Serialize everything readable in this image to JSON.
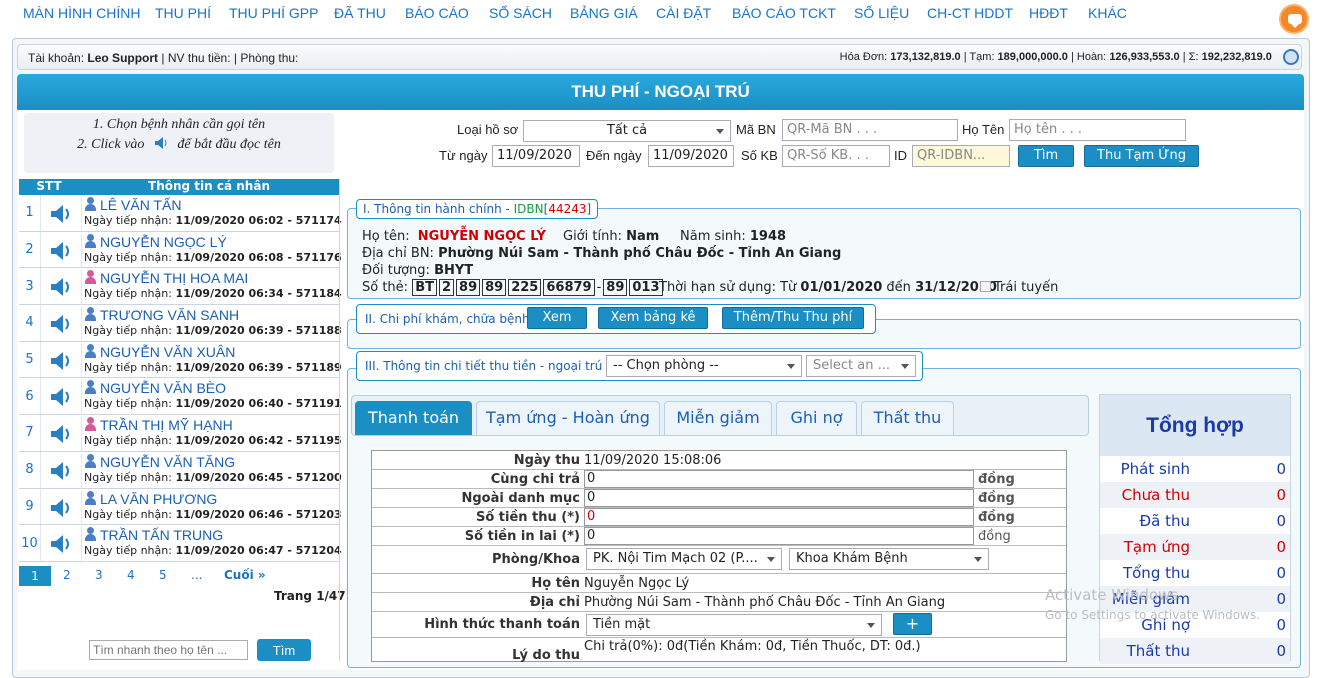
{
  "nav": {
    "items": [
      "MÀN HÌNH CHÍNH",
      "THU PHÍ",
      "THU PHÍ GPP",
      "ĐÃ THU",
      "BÁO CÁO",
      "SỔ SÁCH",
      "BẢNG GIÁ",
      "CÀI ĐẶT",
      "BÁO CÁO TCKT",
      "SỐ LIỆU",
      "CH-CT HDDT",
      "HĐĐT",
      "KHÁC"
    ]
  },
  "account": {
    "tk_label": "Tài khoản:",
    "tk_value": "Leo Support",
    "nv_label": "| NV thu tiền: | Phòng thu:",
    "hoadon_label": "Hóa Đơn:",
    "hoadon_value": "173,132,819.0",
    "tamung_label": "| Tạm:",
    "tamung_value": "189,000,000.0",
    "hoan_label": "| Hoàn:",
    "hoan_value": "126,933,553.0",
    "tong_label": "| Σ:",
    "tong_value": "192,232,819.0"
  },
  "title": "THU PHÍ - NGOẠI TRÚ",
  "instructions": {
    "line1": "1. Chọn bệnh nhân cần gọi tên",
    "line2a": "2. Click vào",
    "line2b": "để bắt đầu đọc tên"
  },
  "list": {
    "col_stt": "STT",
    "col_info": "Thông tin cá nhân",
    "date_label": "Ngày tiếp nhận:",
    "rows": [
      {
        "stt": "1",
        "name": "LÊ VĂN TẤN",
        "date": "11/09/2020 06:02 - 571174",
        "gender": "male"
      },
      {
        "stt": "2",
        "name": "NGUYỄN NGỌC LÝ",
        "date": "11/09/2020 06:08 - 571176",
        "gender": "male"
      },
      {
        "stt": "3",
        "name": "NGUYỄN THỊ HOA MAI",
        "date": "11/09/2020 06:34 - 571184",
        "gender": "female"
      },
      {
        "stt": "4",
        "name": "TRƯƠNG VĂN SANH",
        "date": "11/09/2020 06:39 - 571188",
        "gender": "male"
      },
      {
        "stt": "5",
        "name": "NGUYỄN VĂN XUÂN",
        "date": "11/09/2020 06:39 - 571189",
        "gender": "male"
      },
      {
        "stt": "6",
        "name": "NGUYỄN VĂN BÈO",
        "date": "11/09/2020 06:40 - 571191",
        "gender": "male"
      },
      {
        "stt": "7",
        "name": "TRẦN THỊ MỸ HẠNH",
        "date": "11/09/2020 06:42 - 571195",
        "gender": "female"
      },
      {
        "stt": "8",
        "name": "NGUYỄN VĂN TĂNG",
        "date": "11/09/2020 06:45 - 571200",
        "gender": "male"
      },
      {
        "stt": "9",
        "name": "LA VĂN PHƯƠNG",
        "date": "11/09/2020 06:46 - 571203",
        "gender": "male"
      },
      {
        "stt": "10",
        "name": "TRẦN TẤN TRUNG",
        "date": "11/09/2020 06:47 - 571204",
        "gender": "male"
      }
    ],
    "pages": [
      "1",
      "2",
      "3",
      "4",
      "5",
      "...",
      "Cuối »"
    ],
    "page_count": "Trang 1/47",
    "quick_search_placeholder": "Tìm nhanh theo họ tên ...",
    "quick_search_button": "Tìm"
  },
  "filter": {
    "loai_ho_so_label": "Loại hồ sơ",
    "loai_ho_so_value": "Tất cả",
    "ma_bn_label": "Mã BN",
    "ma_bn_placeholder": "QR-Mã BN . . .",
    "ho_ten_label": "Họ Tên",
    "ho_ten_placeholder": "Họ tên . . .",
    "tu_ngay_label": "Từ ngày",
    "tu_ngay_value": "11/09/2020",
    "den_ngay_label": "Đến ngày",
    "den_ngay_value": "11/09/2020",
    "so_kb_label": "Số KB",
    "so_kb_placeholder": "QR-Số KB. . .",
    "id_label": "ID",
    "id_placeholder": "QR-IDBN...",
    "search_button": "Tìm",
    "advance_button": "Thu Tạm Ứng"
  },
  "section1": {
    "legend_a": "I. Thông tin hành chính - ",
    "legend_idbn": "IDBN",
    "legend_b": "[",
    "legend_id": "44243",
    "legend_c": "]",
    "hoten_label": "Họ tên:",
    "hoten_value": "NGUYỄN NGỌC LÝ",
    "gioitinh_label": "Giới tính:",
    "gioitinh_value": "Nam",
    "namsinh_label": "Năm sinh:",
    "namsinh_value": "1948",
    "diachi_label": "Địa chỉ BN:",
    "diachi_value": "Phường Núi Sam - Thành phố Châu Đốc - Tỉnh An Giang",
    "doituong_label": "Đối tượng:",
    "doituong_value": "BHYT",
    "sothe_label": "Số thẻ:",
    "sothe_parts": [
      "BT",
      "2",
      "89",
      "89",
      "225",
      "66879",
      "-",
      "89",
      "013"
    ],
    "thoihan_label": "Thời hạn sử dụng: Từ",
    "thoihan_from": "01/01/2020",
    "thoihan_mid": "đến",
    "thoihan_to": "31/12/2020",
    "traituyen_label": "Trái tuyến"
  },
  "section2": {
    "legend": "II. Chi phí khám, chữa bệnh",
    "btn_xem": "Xem",
    "btn_bangke": "Xem bảng kê",
    "btn_them": "Thêm/Thu Thu phí"
  },
  "section3": {
    "legend": "III. Thông tin chi tiết thu tiền - ngoại trú |",
    "room_select": "-- Chọn phòng --",
    "select_an": "Select an ..."
  },
  "tabs": [
    "Thanh toán",
    "Tạm ứng - Hoàn ứng",
    "Miễn giảm",
    "Ghi nợ",
    "Thất thu"
  ],
  "payment": {
    "ngaythu_label": "Ngày thu",
    "ngaythu_value": "11/09/2020 15:08:06",
    "cungchitra_label": "Cùng chi trả",
    "cungchitra_value": "0",
    "ngoaidanhmuc_label": "Ngoài danh mục",
    "ngoaidanhmuc_value": "0",
    "sotienthu_label": "Số tiền thu (*)",
    "sotienthu_value": "0",
    "sotieninlai_label": "Số tiền in lai (*)",
    "sotieninlai_value": "0",
    "unit": "đồng",
    "phongkhoa_label": "Phòng/Khoa",
    "phong_value": "PK. Nội Tim Mạch 02 (P....",
    "khoa_value": "Khoa Khám Bệnh",
    "hoten_label": "Họ tên",
    "hoten_value": "Nguyễn Ngọc Lý",
    "diachi_label": "Địa chỉ",
    "diachi_value": "Phường Núi Sam - Thành phố Châu Đốc - Tỉnh An Giang",
    "hinhthuc_label": "Hình thức thanh toán",
    "hinhthuc_value": "Tiền mặt",
    "plus_button": "+",
    "lydo_label": "Lý do thu",
    "lydo_value": "Chi trả(0%): 0đ(Tiền Khám: 0đ, Tiền Thuốc, DT: 0đ.)"
  },
  "summary": {
    "title": "Tổng hợp",
    "rows": [
      {
        "label": "Phát sinh",
        "value": "0",
        "color": "#1a3aaa"
      },
      {
        "label": "Chưa thu",
        "value": "0",
        "color": "#d10000"
      },
      {
        "label": "Đã thu",
        "value": "0",
        "color": "#1a3aaa"
      },
      {
        "label": "Tạm ứng",
        "value": "0",
        "color": "#d10000"
      },
      {
        "label": "Tổng thu",
        "value": "0",
        "color": "#1a3aaa"
      },
      {
        "label": "Miễn giảm",
        "value": "0",
        "color": "#1a3aaa"
      },
      {
        "label": "Ghi nợ",
        "value": "0",
        "color": "#1a3aaa"
      },
      {
        "label": "Thất thu",
        "value": "0",
        "color": "#1a3aaa"
      }
    ]
  },
  "watermark": {
    "line1": "Activate Windows",
    "line2": "Go to Settings to activate Windows."
  }
}
